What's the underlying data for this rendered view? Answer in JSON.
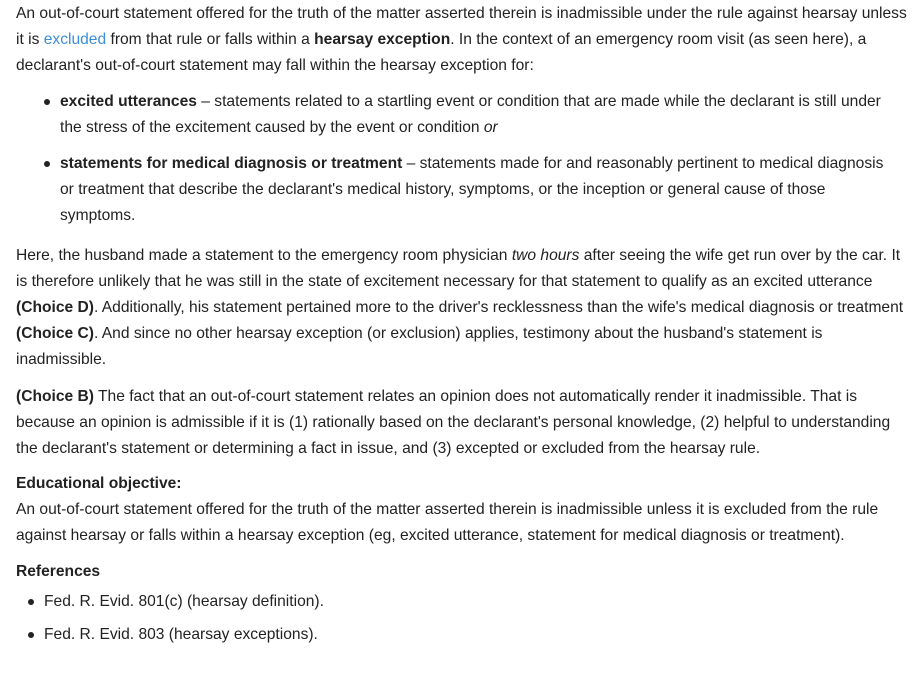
{
  "intro": {
    "t1": "An out-of-court statement offered for the truth of the matter asserted therein is inadmissible under the rule against hearsay unless it is ",
    "link": "excluded",
    "t2": " from that rule or falls within a ",
    "bold": "hearsay exception",
    "t3": ".  In the context of an emergency room visit (as seen here), a declarant's out-of-court statement may fall within the hearsay exception for:"
  },
  "bullets": [
    {
      "term": "excited utterances",
      "text": " – statements related to a startling event or condition that are made while the declarant is still under the stress of the excitement caused by the event or condition ",
      "tail": "or"
    },
    {
      "term": "statements for medical diagnosis or treatment",
      "text": " – statements made for and reasonably pertinent to medical diagnosis or treatment that describe the declarant's medical history, symptoms, or the inception or general cause of those symptoms."
    }
  ],
  "here": {
    "t1": "Here, the husband made a statement to the emergency room physician ",
    "italic": "two hours",
    "t2": " after seeing the wife get run over by the car.  It is therefore unlikely that he was still in the state of excitement necessary for that statement to qualify as an excited utterance ",
    "choice_d": "(Choice D)",
    "t3": ".  Additionally, his statement pertained more to the driver's recklessness than the wife's medical diagnosis or treatment ",
    "choice_c": "(Choice C)",
    "t4": ".  And since no other hearsay exception (or exclusion) applies, testimony about the husband's statement is inadmissible."
  },
  "choice_b": {
    "label": "(Choice B)",
    "text": "  The fact that an out-of-court statement relates an opinion does not automatically render it inadmissible.  That is because an opinion is admissible if it is (1) rationally based on the declarant's personal knowledge, (2) helpful to understanding the declarant's statement or determining a fact in issue, and (3) excepted or excluded from the hearsay rule."
  },
  "objective": {
    "heading": "Educational objective:",
    "text": "An out-of-court statement offered for the truth of the matter asserted therein is inadmissible unless it is excluded from the rule against hearsay or falls within a hearsay exception (eg, excited utterance, statement for medical diagnosis or treatment)."
  },
  "references": {
    "heading": "References",
    "items": [
      "Fed. R. Evid. 801(c) (hearsay definition).",
      "Fed. R. Evid. 803 (hearsay exceptions)."
    ]
  },
  "colors": {
    "text": "#222222",
    "link": "#3b8ed8",
    "background": "#ffffff"
  }
}
